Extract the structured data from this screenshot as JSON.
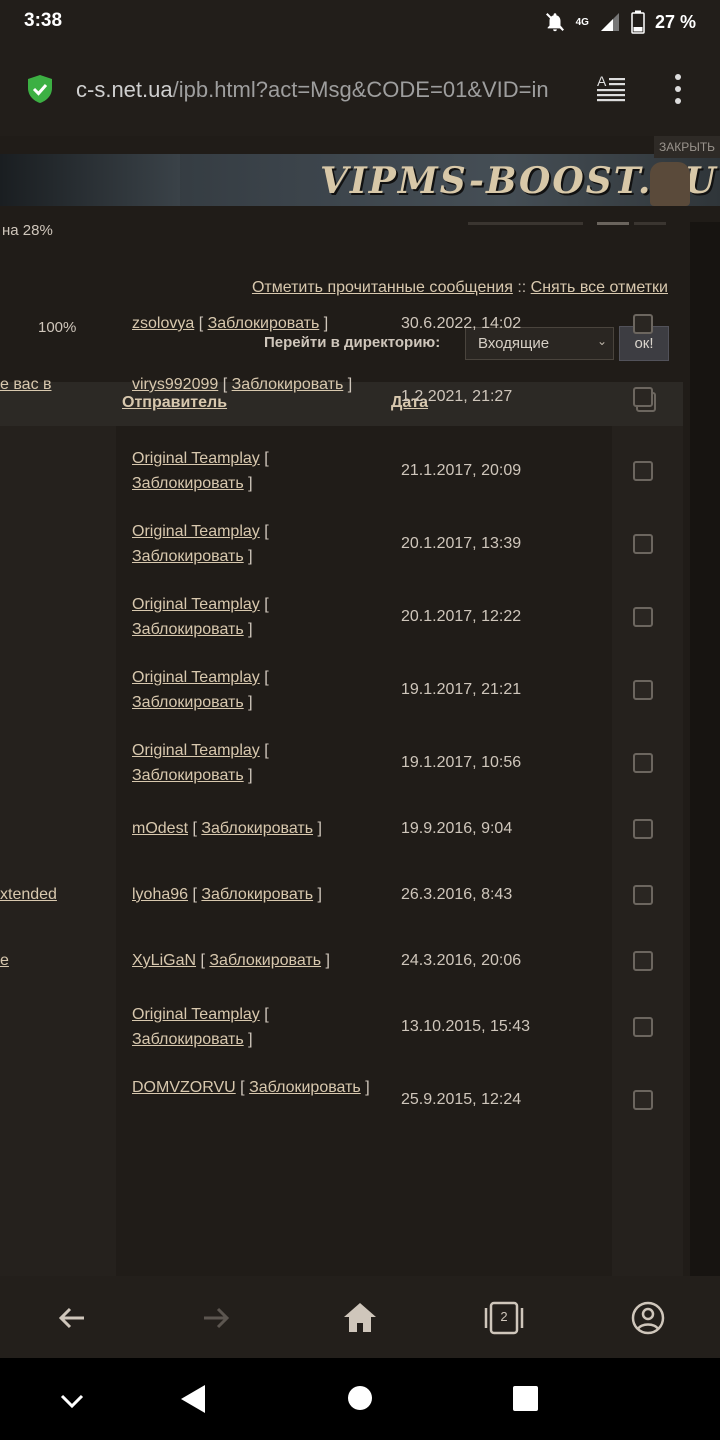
{
  "status": {
    "time": "3:38",
    "network": "4G",
    "battery": "27 %"
  },
  "browser": {
    "url_domain": "c-s.net.ua",
    "url_path": "/ipb.html?act=Msg&CODE=01&VID=in"
  },
  "ad": {
    "close_label": "ЗАКРЫТЬ",
    "banner_text": "VIPMS-BOOST.RU"
  },
  "folder": {
    "usage_text": "на 28%",
    "percent_label": "100%"
  },
  "actions": {
    "mark_read": "Отметить прочитанные сообщения",
    "separator": "::",
    "unmark_all": "Снять все отметки"
  },
  "directory": {
    "label": "Перейти в директорию:",
    "selected": "Входящие",
    "ok_label": "ок!"
  },
  "table": {
    "headers": {
      "sender": "Отправитель",
      "date": "Дата"
    },
    "rows": [
      {
        "subject": "",
        "sender": "zsolovya",
        "block": "Заблокировать",
        "date": "30.6.2022, 14:02"
      },
      {
        "subject": "е вас в",
        "sender": "virys992099",
        "block": "Заблокировать",
        "date": "1.2.2021, 21:27"
      },
      {
        "subject": "",
        "sender": "Original Teamplay",
        "block": "Заблокировать",
        "date": "21.1.2017, 20:09"
      },
      {
        "subject": "",
        "sender": "Original Teamplay",
        "block": "Заблокировать",
        "date": "20.1.2017, 13:39"
      },
      {
        "subject": "",
        "sender": "Original Teamplay",
        "block": "Заблокировать",
        "date": "20.1.2017, 12:22"
      },
      {
        "subject": "",
        "sender": "Original Teamplay",
        "block": "Заблокировать",
        "date": "19.1.2017, 21:21"
      },
      {
        "subject": "",
        "sender": "Original Teamplay",
        "block": "Заблокировать",
        "date": "19.1.2017, 10:56"
      },
      {
        "subject": "",
        "sender": "mOdest",
        "block": "Заблокировать",
        "date": "19.9.2016, 9:04"
      },
      {
        "subject": "xtended",
        "sender": "lyoha96",
        "block": "Заблокировать",
        "date": "26.3.2016, 8:43"
      },
      {
        "subject": "e",
        "sender": "XyLiGaN",
        "block": "Заблокировать",
        "date": "24.3.2016, 20:06"
      },
      {
        "subject": "",
        "sender": "Original Teamplay",
        "block": "Заблокировать",
        "date": "13.10.2015, 15:43"
      },
      {
        "subject": "",
        "sender": "DOMVZORVU",
        "block": "Заблокировать",
        "date": "25.9.2015, 12:24"
      }
    ]
  },
  "bottom_nav": {
    "tab_count": "2"
  },
  "colors": {
    "background": "#201c18",
    "link": "#d8c8ae",
    "text": "#cfc6bb",
    "secure": "#3cb043"
  }
}
